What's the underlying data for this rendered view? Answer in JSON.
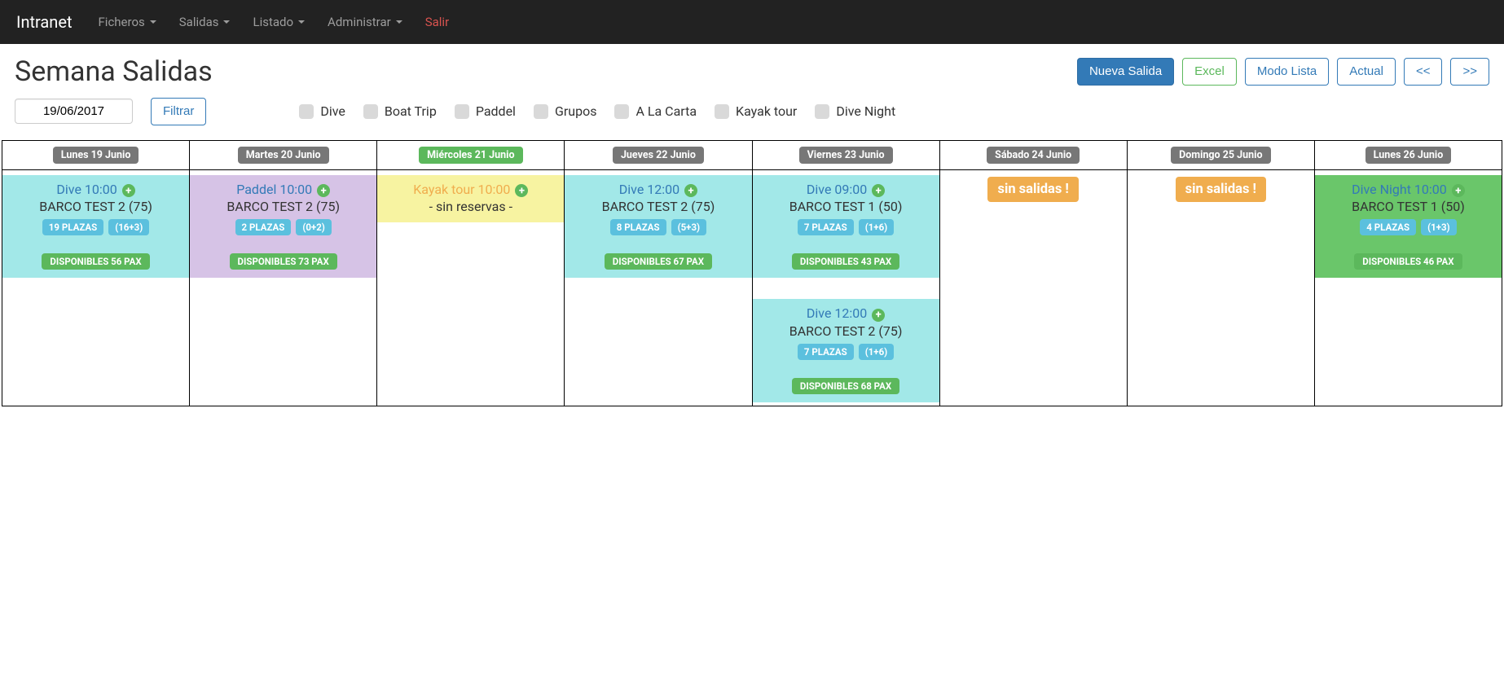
{
  "nav": {
    "brand": "Intranet",
    "items": [
      "Ficheros",
      "Salidas",
      "Listado",
      "Administrar"
    ],
    "logout": "Salir"
  },
  "header": {
    "title": "Semana Salidas",
    "actions": {
      "new": "Nueva Salida",
      "excel": "Excel",
      "list_mode": "Modo Lista",
      "actual": "Actual",
      "prev": "<<",
      "next": ">>"
    }
  },
  "filter": {
    "date": "19/06/2017",
    "btn": "Filtrar",
    "checks": [
      "Dive",
      "Boat Trip",
      "Paddel",
      "Grupos",
      "A La Carta",
      "Kayak tour",
      "Dive Night"
    ]
  },
  "days": [
    {
      "label": "Lunes 19 Junio",
      "active": false,
      "trips": [
        {
          "type": "dive",
          "title": "Dive 10:00",
          "sub": "BARCO TEST 2 (75)",
          "plazas": "19 PLAZAS",
          "breakdown": "(16+3)",
          "avail": "DISPONIBLES 56 PAX"
        }
      ]
    },
    {
      "label": "Martes 20 Junio",
      "active": false,
      "trips": [
        {
          "type": "paddel",
          "title": "Paddel 10:00",
          "sub": "BARCO TEST 2 (75)",
          "plazas": "2 PLAZAS",
          "breakdown": "(0+2)",
          "avail": "DISPONIBLES 73 PAX"
        }
      ]
    },
    {
      "label": "Miércoles 21 Junio",
      "active": true,
      "trips": [
        {
          "type": "kayak",
          "title": "Kayak tour 10:00",
          "sub": "- sin reservas -"
        }
      ]
    },
    {
      "label": "Jueves 22 Junio",
      "active": false,
      "trips": [
        {
          "type": "dive",
          "title": "Dive 12:00",
          "sub": "BARCO TEST 2 (75)",
          "plazas": "8 PLAZAS",
          "breakdown": "(5+3)",
          "avail": "DISPONIBLES 67 PAX"
        }
      ]
    },
    {
      "label": "Viernes 23 Junio",
      "active": false,
      "trips": [
        {
          "type": "dive",
          "title": "Dive 09:00",
          "sub": "BARCO TEST 1 (50)",
          "plazas": "7 PLAZAS",
          "breakdown": "(1+6)",
          "avail": "DISPONIBLES 43 PAX"
        },
        {
          "type": "dive",
          "title": "Dive 12:00",
          "sub": "BARCO TEST 2 (75)",
          "plazas": "7 PLAZAS",
          "breakdown": "(1+6)",
          "avail": "DISPONIBLES 68 PAX"
        }
      ]
    },
    {
      "label": "Sábado 24 Junio",
      "active": false,
      "empty": "sin salidas !"
    },
    {
      "label": "Domingo 25 Junio",
      "active": false,
      "empty": "sin salidas !"
    },
    {
      "label": "Lunes 26 Junio",
      "active": false,
      "trips": [
        {
          "type": "night",
          "title": "Dive Night 10:00",
          "sub": "BARCO TEST 1 (50)",
          "plazas": "4 PLAZAS",
          "breakdown": "(1+3)",
          "avail": "DISPONIBLES 46 PAX"
        }
      ]
    }
  ]
}
